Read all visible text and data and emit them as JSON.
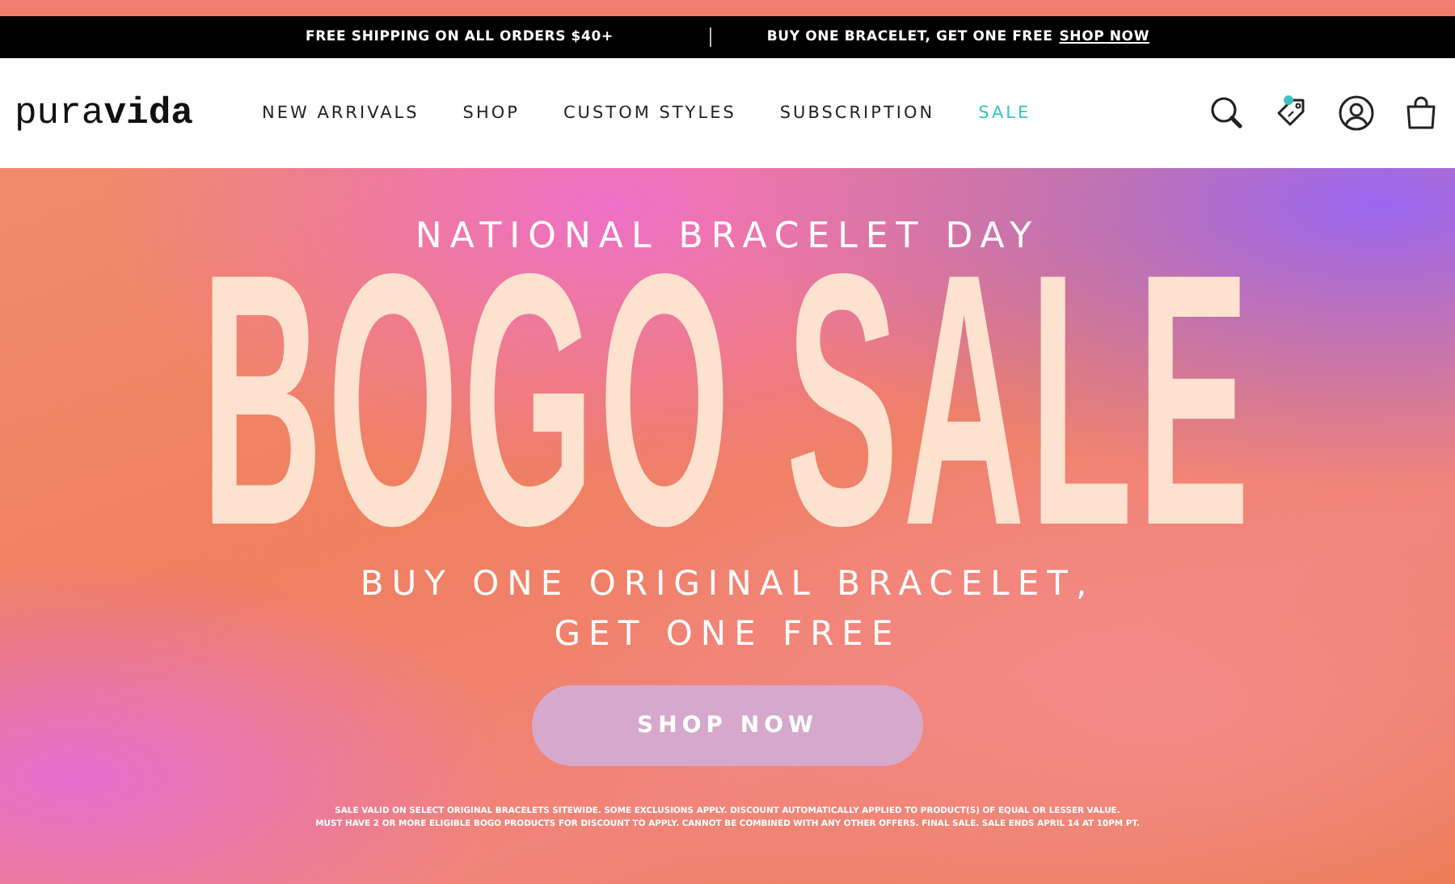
{
  "announcement_bar": {
    "left": "FREE SHIPPING ON ALL ORDERS $40+",
    "right": "BUY ONE BRACELET, GET ONE FREE",
    "link": "SHOP NOW"
  },
  "header": {
    "logo": {
      "light": "pura",
      "bold": "vida"
    },
    "nav": [
      {
        "label": "NEW ARRIVALS",
        "kind": "regular"
      },
      {
        "label": "SHOP",
        "kind": "regular"
      },
      {
        "label": "CUSTOM STYLES",
        "kind": "regular"
      },
      {
        "label": "SUBSCRIPTION",
        "kind": "regular"
      },
      {
        "label": "SALE",
        "kind": "sale"
      }
    ],
    "rewards_notification": true
  },
  "hero": {
    "eyebrow": "NATIONAL BRACELET DAY",
    "headline": "BOGO SALE",
    "subhead_lines": [
      "BUY ONE ORIGINAL BRACELET,",
      "GET ONE FREE"
    ],
    "button": "SHOP NOW",
    "fine_print": [
      "SALE VALID ON SELECT ORIGINAL BRACELETS SITEWIDE. SOME EXCLUSIONS APPLY. DISCOUNT AUTOMATICALLY APPLIED TO PRODUCT(S) OF EQUAL OR LESSER VALUE.",
      "MUST HAVE 2 OR MORE ELIGIBLE BOGO PRODUCTS FOR DISCOUNT TO APPLY. CANNOT BE COMBINED WITH ANY OTHER OFFERS. FINAL SALE. SALE ENDS APRIL 14 AT 10PM PT."
    ]
  }
}
